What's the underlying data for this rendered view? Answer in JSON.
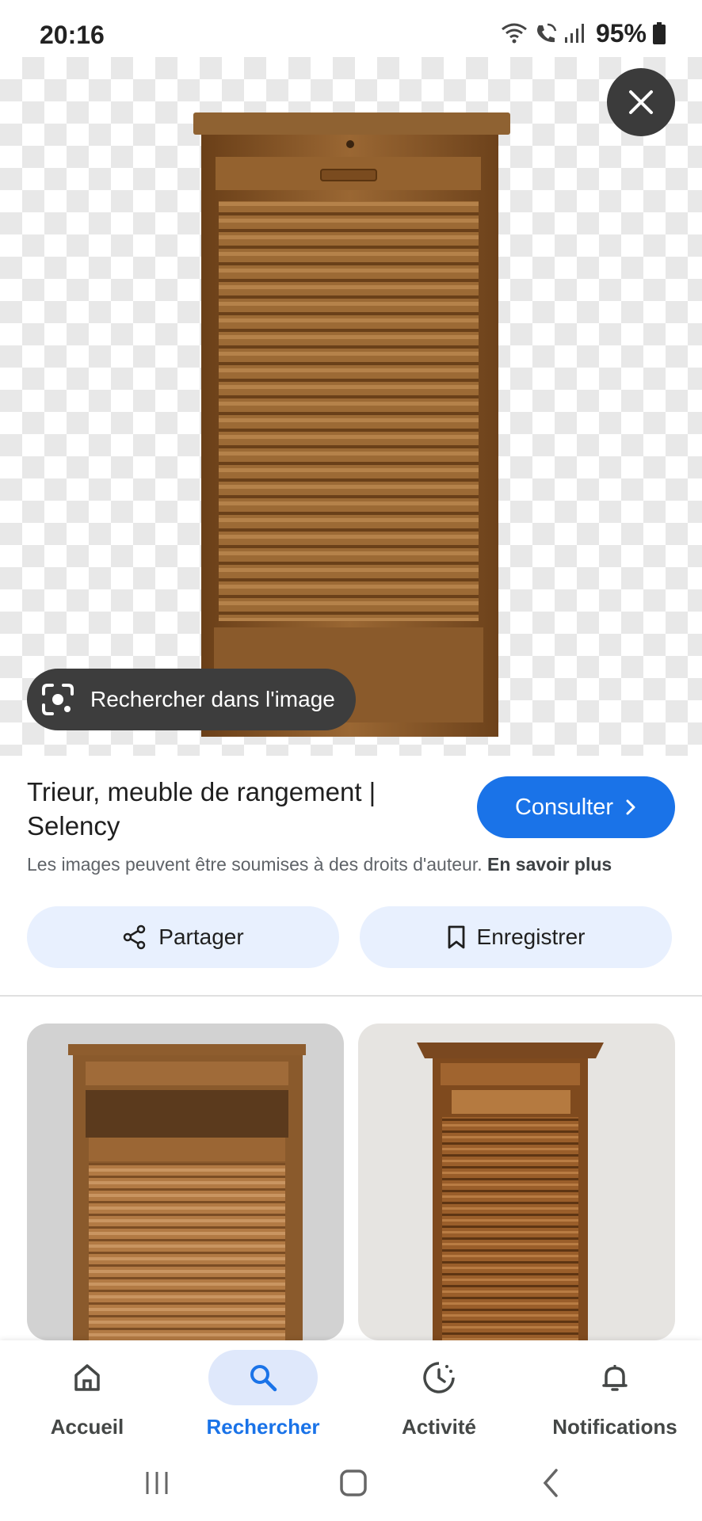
{
  "status_bar": {
    "time": "20:16",
    "battery": "95%",
    "icons": [
      "wifi-icon",
      "wifi-calling-icon",
      "signal-icon",
      "battery-icon"
    ]
  },
  "viewer": {
    "close_icon": "close-icon",
    "lens_chip_label": "Rechercher dans l'image"
  },
  "result": {
    "title": "Trieur, meuble de rangement | Selency",
    "visit_label": "Consulter",
    "copyright_text": "Les images peuvent être soumises à des droits d'auteur.",
    "learn_more": "En savoir plus"
  },
  "actions": {
    "share_label": "Partager",
    "save_label": "Enregistrer"
  },
  "bottom_nav": {
    "items": [
      {
        "label": "Accueil",
        "icon": "home-icon"
      },
      {
        "label": "Rechercher",
        "icon": "search-icon",
        "active": true
      },
      {
        "label": "Activité",
        "icon": "activity-icon"
      },
      {
        "label": "Notifications",
        "icon": "bell-icon"
      }
    ]
  },
  "colors": {
    "accent": "#1a73e8",
    "pill_bg": "#e8f0fe",
    "chip_bg": "#3d3d3d",
    "wood": "#8a5a2b"
  }
}
